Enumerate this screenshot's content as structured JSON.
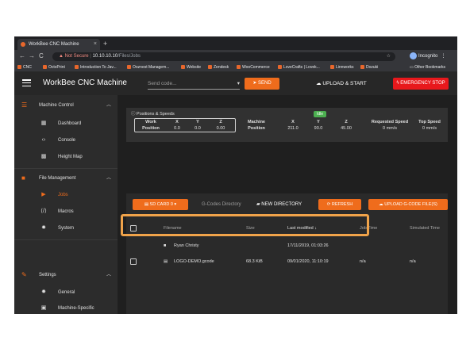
{
  "browser": {
    "tab_title": "WorkBee CNC Machine",
    "tab_close": "×",
    "new_tab": "+",
    "back": "←",
    "forward": "→",
    "reload": "C",
    "not_secure": "Not Secure",
    "url_host": "10.10.10.10",
    "url_path": "/Files/Jobs",
    "star": "☆",
    "incognito": "Incognito",
    "bookmarks": [
      "CNC",
      "OctoPrint",
      "Introduction To Jav...",
      "Ooznest Managem...",
      "Website",
      "Zendesk",
      "WooCommerce",
      "LoveCrafts | Lovek...",
      "Linnworks",
      "Dozuki"
    ],
    "other_bookmarks": "Other Bookmarks"
  },
  "header": {
    "title": "WorkBee CNC Machine",
    "send_placeholder": "Send code...",
    "send_label": "SEND",
    "upload_start_label": "UPLOAD & START",
    "estop_label": "EMERGENCY STOP"
  },
  "sidebar": {
    "machine_control": "Machine Control",
    "mc_items": [
      "Dashboard",
      "Console",
      "Height Map"
    ],
    "file_management": "File Management",
    "fm_items": [
      "Jobs",
      "Macros",
      "System"
    ],
    "settings": "Settings",
    "st_items": [
      "General",
      "Machine-Specific"
    ]
  },
  "positions": {
    "title": "Positions & Speeds",
    "status": "Idle",
    "work_label_1": "Work",
    "work_label_2": "Position",
    "axes": [
      "X",
      "Y",
      "Z"
    ],
    "work_values": [
      "0.0",
      "0.0",
      "0.00"
    ],
    "machine_label_1": "Machine",
    "machine_label_2": "Position",
    "machine_values": [
      "211.0",
      "90.0",
      "45.00"
    ],
    "requested_speed_label": "Requested Speed",
    "requested_speed_value": "0 mm/s",
    "top_speed_label": "Top Speed",
    "top_speed_value": "0 mm/s"
  },
  "files": {
    "sd_card_label": "SD CARD 0",
    "directory_label": "G-Codes Directory",
    "new_directory_label": "NEW DIRECTORY",
    "refresh_label": "REFRESH",
    "upload_label": "UPLOAD G-CODE FILE(S)",
    "columns": [
      "Filename",
      "Size",
      "Last modified",
      "Job Time",
      "Simulated Time"
    ],
    "rows": [
      {
        "name": "Ryan Christy",
        "size": "",
        "modified": "17/11/2019, 01:03:26",
        "job_time": "",
        "sim_time": ""
      },
      {
        "name": "LOGO-DEMO.gcode",
        "size": "68.3 KiB",
        "modified": "09/01/2020, 11:10:19",
        "job_time": "n/a",
        "sim_time": "n/a"
      }
    ]
  },
  "colors": {
    "accent": "#ef6c1c",
    "estop": "#e8181c",
    "idle": "#4caf50",
    "highlight": "#f0a34a"
  }
}
